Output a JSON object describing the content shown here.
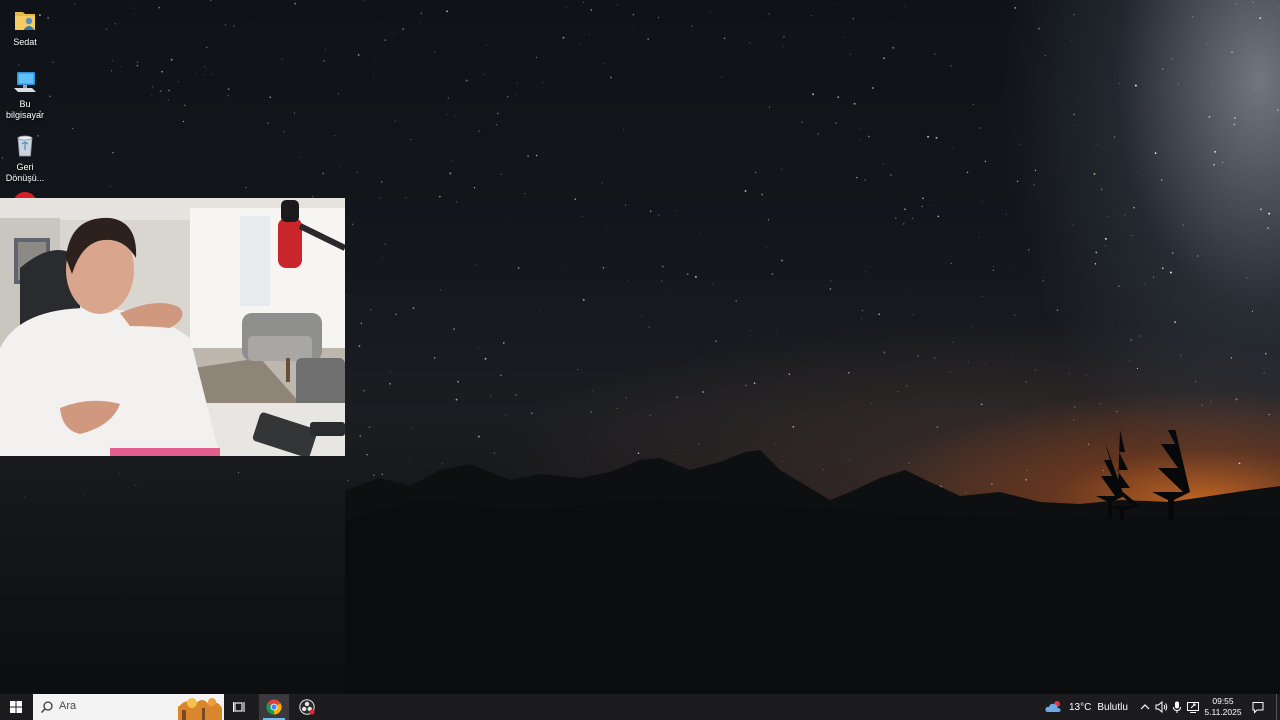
{
  "desktop": {
    "icons": [
      {
        "label": "Sedat",
        "icon": "user-folder-icon"
      },
      {
        "label": "Bu bilgisayar",
        "icon": "computer-icon"
      },
      {
        "label": "Geri Dönüşü...",
        "icon": "recycle-bin-icon"
      }
    ]
  },
  "taskbar": {
    "search": {
      "placeholder": "Ara",
      "icon": "search-icon"
    },
    "apps": [
      {
        "name": "chrome",
        "icon": "chrome-icon",
        "active": true
      },
      {
        "name": "obs",
        "icon": "obs-icon",
        "active": false
      }
    ],
    "weather": {
      "temperature": "13°C",
      "condition": "Bulutlu",
      "icon": "cloudy-weather-icon"
    },
    "clock": {
      "time": "09:55",
      "date": "5.11.2025"
    },
    "colors": {
      "background": "#1c1c1f",
      "accent": "#76b9ed"
    }
  }
}
